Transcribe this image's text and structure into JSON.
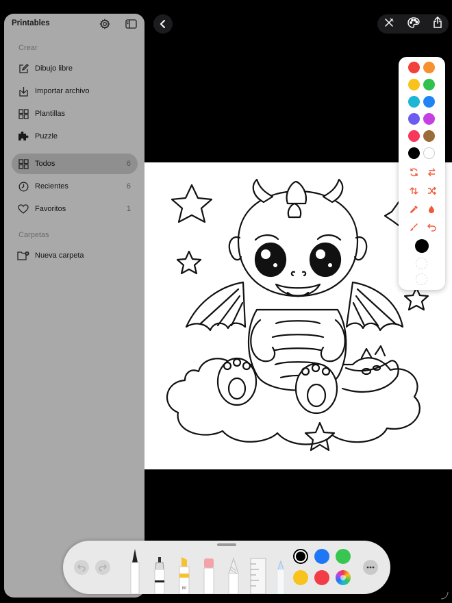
{
  "sidebar": {
    "title": "Printables",
    "sections": {
      "create": "Crear",
      "folders": "Carpetas"
    },
    "create_items": [
      {
        "label": "Dibujo libre",
        "icon": "pencil-square-icon"
      },
      {
        "label": "Importar archivo",
        "icon": "import-icon"
      },
      {
        "label": "Plantillas",
        "icon": "grid-icon"
      },
      {
        "label": "Puzzle",
        "icon": "puzzle-icon"
      }
    ],
    "library_items": [
      {
        "label": "Todos",
        "count": "6",
        "icon": "grid-icon",
        "selected": true
      },
      {
        "label": "Recientes",
        "count": "6",
        "icon": "clock-icon"
      },
      {
        "label": "Favoritos",
        "count": "1",
        "icon": "heart-icon"
      }
    ],
    "new_folder": "Nueva carpeta"
  },
  "palette": {
    "swatches": [
      "#f2413b",
      "#f7902f",
      "#f7c31c",
      "#32c14e",
      "#1cb7d6",
      "#1f85f5",
      "#6b5cf2",
      "#c540e3",
      "#f6395a",
      "#9c6b3a",
      "#000000",
      "#ffffff"
    ],
    "actions_accent": "#f05a3b",
    "selected_color": "#000000"
  },
  "toolbar": {
    "colors": [
      "#000000",
      "#1f77f5",
      "#39c552",
      "#f7c31c",
      "#f23c46"
    ],
    "selected_color": "#000000",
    "marker_label": "80"
  },
  "accent": "#f05a3b"
}
